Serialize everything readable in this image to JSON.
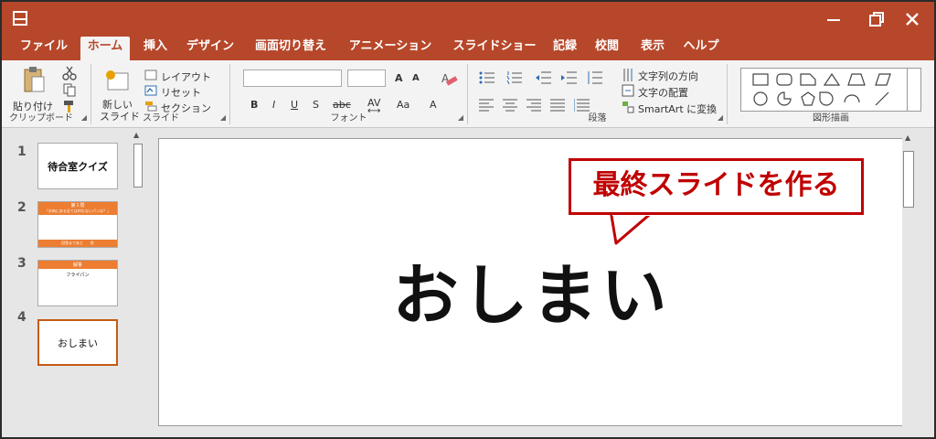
{
  "window": {
    "accent": "#b7472a"
  },
  "tabs": [
    {
      "label": "ファイル",
      "active": false
    },
    {
      "label": "ホーム",
      "active": true
    },
    {
      "label": "挿入",
      "active": false
    },
    {
      "label": "デザイン",
      "active": false
    },
    {
      "label": "画面切り替え",
      "active": false
    },
    {
      "label": "アニメーション",
      "active": false
    },
    {
      "label": "スライドショー",
      "active": false
    },
    {
      "label": "記録",
      "active": false
    },
    {
      "label": "校閲",
      "active": false
    },
    {
      "label": "表示",
      "active": false
    },
    {
      "label": "ヘルプ",
      "active": false
    }
  ],
  "ribbon": {
    "clipboard": {
      "paste": "貼り付け",
      "label": "クリップボード"
    },
    "slides": {
      "new_slide_line1": "新しい",
      "new_slide_line2": "スライド",
      "layout": "レイアウト",
      "reset": "リセット",
      "section": "セクション",
      "label": "スライド"
    },
    "font": {
      "label": "フォント",
      "bold": "B",
      "italic": "I",
      "underline": "U",
      "shadow": "S",
      "strike": "abc",
      "spacing": "AV",
      "case": "Aa",
      "color": "A",
      "grow": "A",
      "shrink": "A"
    },
    "paragraph": {
      "label": "段落",
      "text_direction": "文字列の方向",
      "align_text": "文字の配置",
      "smartart": "SmartArt に変換"
    },
    "drawing": {
      "label": "図形描画"
    }
  },
  "slides": [
    {
      "number": "1",
      "title": "待合室クイズ",
      "selected": false
    },
    {
      "number": "2",
      "title": "第１問",
      "subtitle": "「お肉にある全ては何もないパンは？」",
      "footer": "回答まであと　　秒",
      "selected": false
    },
    {
      "number": "3",
      "title": "解答",
      "subtitle": "フライパン",
      "selected": false
    },
    {
      "number": "4",
      "title": "おしまい",
      "selected": true
    }
  ],
  "current_slide": {
    "text": "おしまい"
  },
  "callout": {
    "text": "最終スライドを作る",
    "color": "#c00000"
  }
}
